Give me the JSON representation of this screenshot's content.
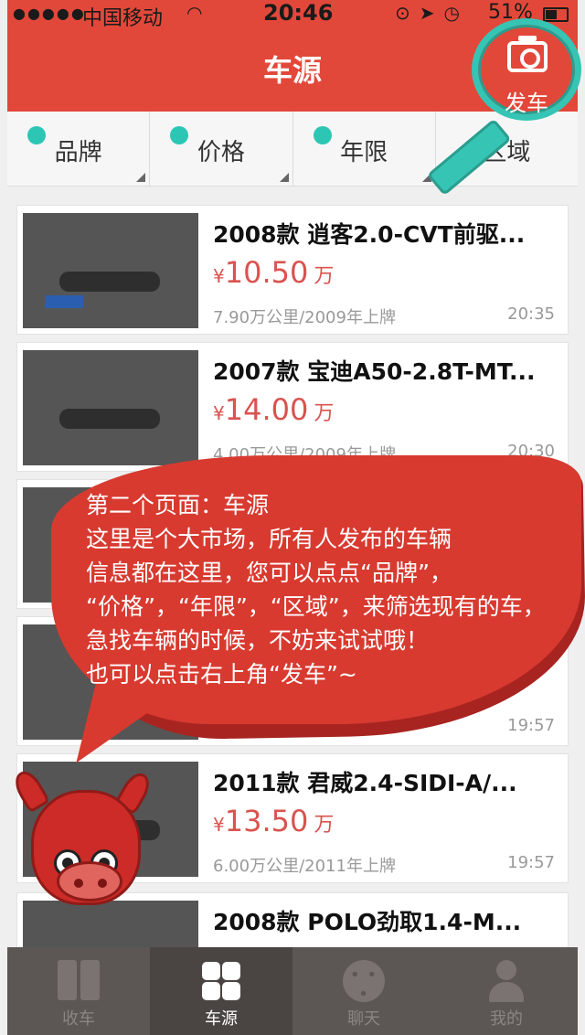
{
  "status_bar": {
    "carrier": "中国移动",
    "time": "20:46",
    "battery": "51%"
  },
  "header": {
    "title": "车源",
    "post_button_label": "发车",
    "post_icon": "camera-icon"
  },
  "filters": [
    {
      "label": "品牌"
    },
    {
      "label": "价格"
    },
    {
      "label": "年限"
    },
    {
      "label": "区域"
    }
  ],
  "listings": [
    {
      "title": "2008款  逍客2.0-CVT前驱...",
      "currency": "¥",
      "price": "10.50",
      "unit": "万",
      "meta": "7.90万公里/2009年上牌",
      "time": "20:35"
    },
    {
      "title": "2007款  宝迪A50-2.8T-MT...",
      "currency": "¥",
      "price": "14.00",
      "unit": "万",
      "meta": "4.00万公里/2009年上牌",
      "time": "20:30"
    },
    {
      "title": "",
      "currency": "",
      "price": "",
      "unit": "",
      "meta": "",
      "time": ""
    },
    {
      "title": "",
      "currency": "",
      "price": "",
      "unit": "",
      "meta": "",
      "time": "19:57"
    },
    {
      "title": "2011款  君威2.4-SIDI-A/...",
      "currency": "¥",
      "price": "13.50",
      "unit": "万",
      "meta": "6.00万公里/2011年上牌",
      "time": "19:57"
    },
    {
      "title": "2008款  POLO劲取1.4-M...",
      "currency": "",
      "price": "",
      "unit": "",
      "meta": "",
      "time": ""
    }
  ],
  "tutorial_bubble": {
    "lines": [
      "第二个页面：车源",
      "这里是个大市场，所有人发布的车辆",
      "信息都在这里，您可以点点“品牌”，",
      "“价格”，“年限”，“区域”，来筛选现有的车，",
      "急找车辆的时候，不妨来试试哦！",
      "也可以点击右上角“发车”~"
    ]
  },
  "tabbar": [
    {
      "label": "收车",
      "icon": "book-icon",
      "active": false
    },
    {
      "label": "车源",
      "icon": "grid-icon",
      "active": true
    },
    {
      "label": "聊天",
      "icon": "chat-icon",
      "active": false
    },
    {
      "label": "我的",
      "icon": "user-icon",
      "active": false
    }
  ],
  "colors": {
    "brand_red": "#e2483a",
    "accent_teal": "#36c4b4",
    "price_red": "#d9534f",
    "tabbar_bg": "#5c5654"
  }
}
